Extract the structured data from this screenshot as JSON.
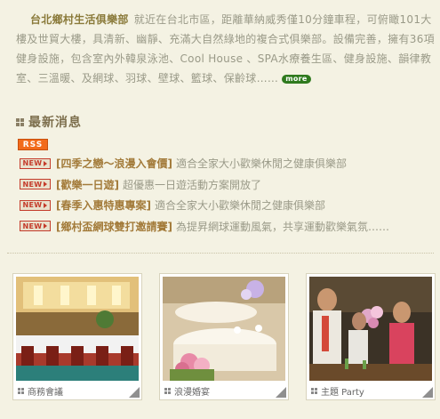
{
  "intro": {
    "club_name": "台北鄉村生活俱樂部",
    "text": "就近在台北市區，距離華納威秀僅10分鐘車程，可俯瞰101大樓及世貿大樓，具清新、幽靜、充滿大自然綠地的複合式俱樂部。設備完善，擁有36項健身設施，包含室內外韓泉泳池、Cool House 、SPA水療養生區、健身設施、韻律教室、三溫暖、及網球、羽球、壁球、籃球、保齡球……",
    "more_label": "more"
  },
  "news": {
    "section_title": "最新消息",
    "rss_label": "RSS",
    "new_label": "NEW",
    "items": [
      {
        "title": "[四季之戀～浪漫入會價]",
        "desc": "適合全家大小歡樂休閒之健康俱樂部"
      },
      {
        "title": "[歡樂一日遊]",
        "desc": "超優惠一日遊活動方案開放了"
      },
      {
        "title": "[春季入惠特惠專案]",
        "desc": "適合全家大小歡樂休閒之健康俱樂部"
      },
      {
        "title": "[鄉村盃網球雙打邀請賽]",
        "desc": "為提昇網球運動風氣，共享運動歡樂氣氛……"
      }
    ]
  },
  "gallery": [
    {
      "label": "商務會議"
    },
    {
      "label": "浪漫婚宴"
    },
    {
      "label": "主題 Party"
    }
  ],
  "colors": {
    "background": "#f4f2e3",
    "club_name": "#8a7a3a",
    "news_title": "#a37b3a",
    "body_text": "#9a9a88",
    "rss": "#f26b1b",
    "new_badge": "#c43b2a",
    "more_badge": "#2f7a1e"
  },
  "icons": [
    "grid-icon",
    "rss-icon",
    "new-icon",
    "more-icon",
    "corner-triangle-icon"
  ]
}
